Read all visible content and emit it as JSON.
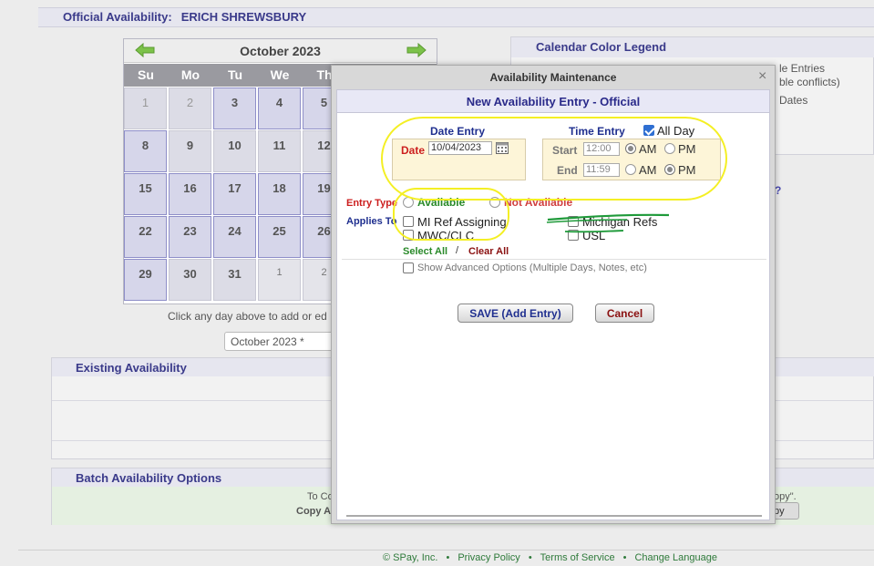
{
  "header": {
    "label": "Official Availability:",
    "official_name": "ERICH SHREWSBURY"
  },
  "calendar": {
    "month_label": "October 2023",
    "weekdays": [
      "Su",
      "Mo",
      "Tu",
      "We",
      "Th"
    ],
    "weeks": [
      [
        "1",
        "2",
        "3",
        "4",
        "5"
      ],
      [
        "8",
        "9",
        "10",
        "11",
        "12"
      ],
      [
        "15",
        "16",
        "17",
        "18",
        "19"
      ],
      [
        "22",
        "23",
        "24",
        "25",
        "26"
      ],
      [
        "29",
        "30",
        "31",
        "1",
        "2"
      ]
    ],
    "hint": "Click any day above to add or ed",
    "month_select": "October 2023 *"
  },
  "legend": {
    "title": "Calendar Color Legend",
    "entries_line1": "le Entries",
    "entries_line2": "ble conflicts)",
    "dates": "Dates",
    "question": "?"
  },
  "existing": {
    "title": "Existing Availability"
  },
  "batch": {
    "title": "Batch Availability Options",
    "line1": "To Co",
    "line2": "Copy A",
    "right_text": "opy\".",
    "copy_btn": "py"
  },
  "footer": {
    "copyright": "© SPay, Inc.",
    "links": [
      "Privacy Policy",
      "Terms of Service",
      "Change Language"
    ],
    "separator": "•"
  },
  "modal": {
    "window_title": "Availability Maintenance",
    "close_glyph": "×",
    "heading": "New Availability Entry - Official",
    "date_entry_label": "Date Entry",
    "date_label": "Date",
    "date_value": "10/04/2023",
    "time_entry_label": "Time Entry",
    "all_day_label": "All Day",
    "all_day_checked": true,
    "start_label": "Start",
    "start_value": "12:00",
    "end_label": "End",
    "end_value": "11:59",
    "am_label": "AM",
    "pm_label": "PM",
    "entry_type_label": "Entry Type",
    "available_label": "Available",
    "not_available_label": "Not Available",
    "applies_to_label": "Applies To",
    "applies_options": [
      "MI Ref Assigning",
      "MWC/CLC",
      "Michigan Refs",
      "USL"
    ],
    "select_all": "Select All",
    "slash": "/",
    "clear_all": "Clear All",
    "advanced_label": "Show Advanced Options (Multiple Days, Notes, etc)",
    "save_button": "SAVE (Add Entry)",
    "cancel_button": "Cancel"
  },
  "colors": {
    "accent": "#3a3a8a",
    "date_label_red": "#cc1e1e",
    "available_green": "#2a8a2a",
    "not_available_red": "#d04040",
    "annotation_yellow": "#f4ef24",
    "strike_green": "#1f9a3a"
  }
}
